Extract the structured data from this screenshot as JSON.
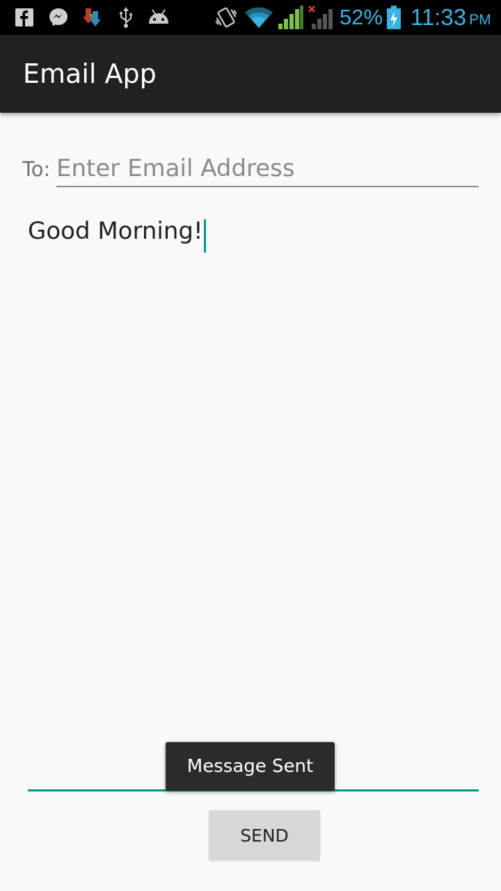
{
  "status_bar": {
    "battery_percent": "52%",
    "time": "11:33",
    "ampm": "PM",
    "icons": [
      "facebook-icon",
      "messenger-icon",
      "download-icon",
      "usb-icon",
      "android-debug-icon",
      "vibrate-icon",
      "wifi-icon",
      "signal-icon",
      "no-signal-icon",
      "battery-charging-icon"
    ],
    "accent_color": "#33b5e5"
  },
  "app_bar": {
    "title": "Email App",
    "color": "#212121"
  },
  "compose": {
    "to_label": "To:",
    "email_placeholder": "Enter Email Address",
    "email_value": "",
    "message_text": "Good Morning!",
    "accent_color": "#009688"
  },
  "toast": {
    "text": "Message Sent"
  },
  "actions": {
    "send_label": "SEND"
  }
}
